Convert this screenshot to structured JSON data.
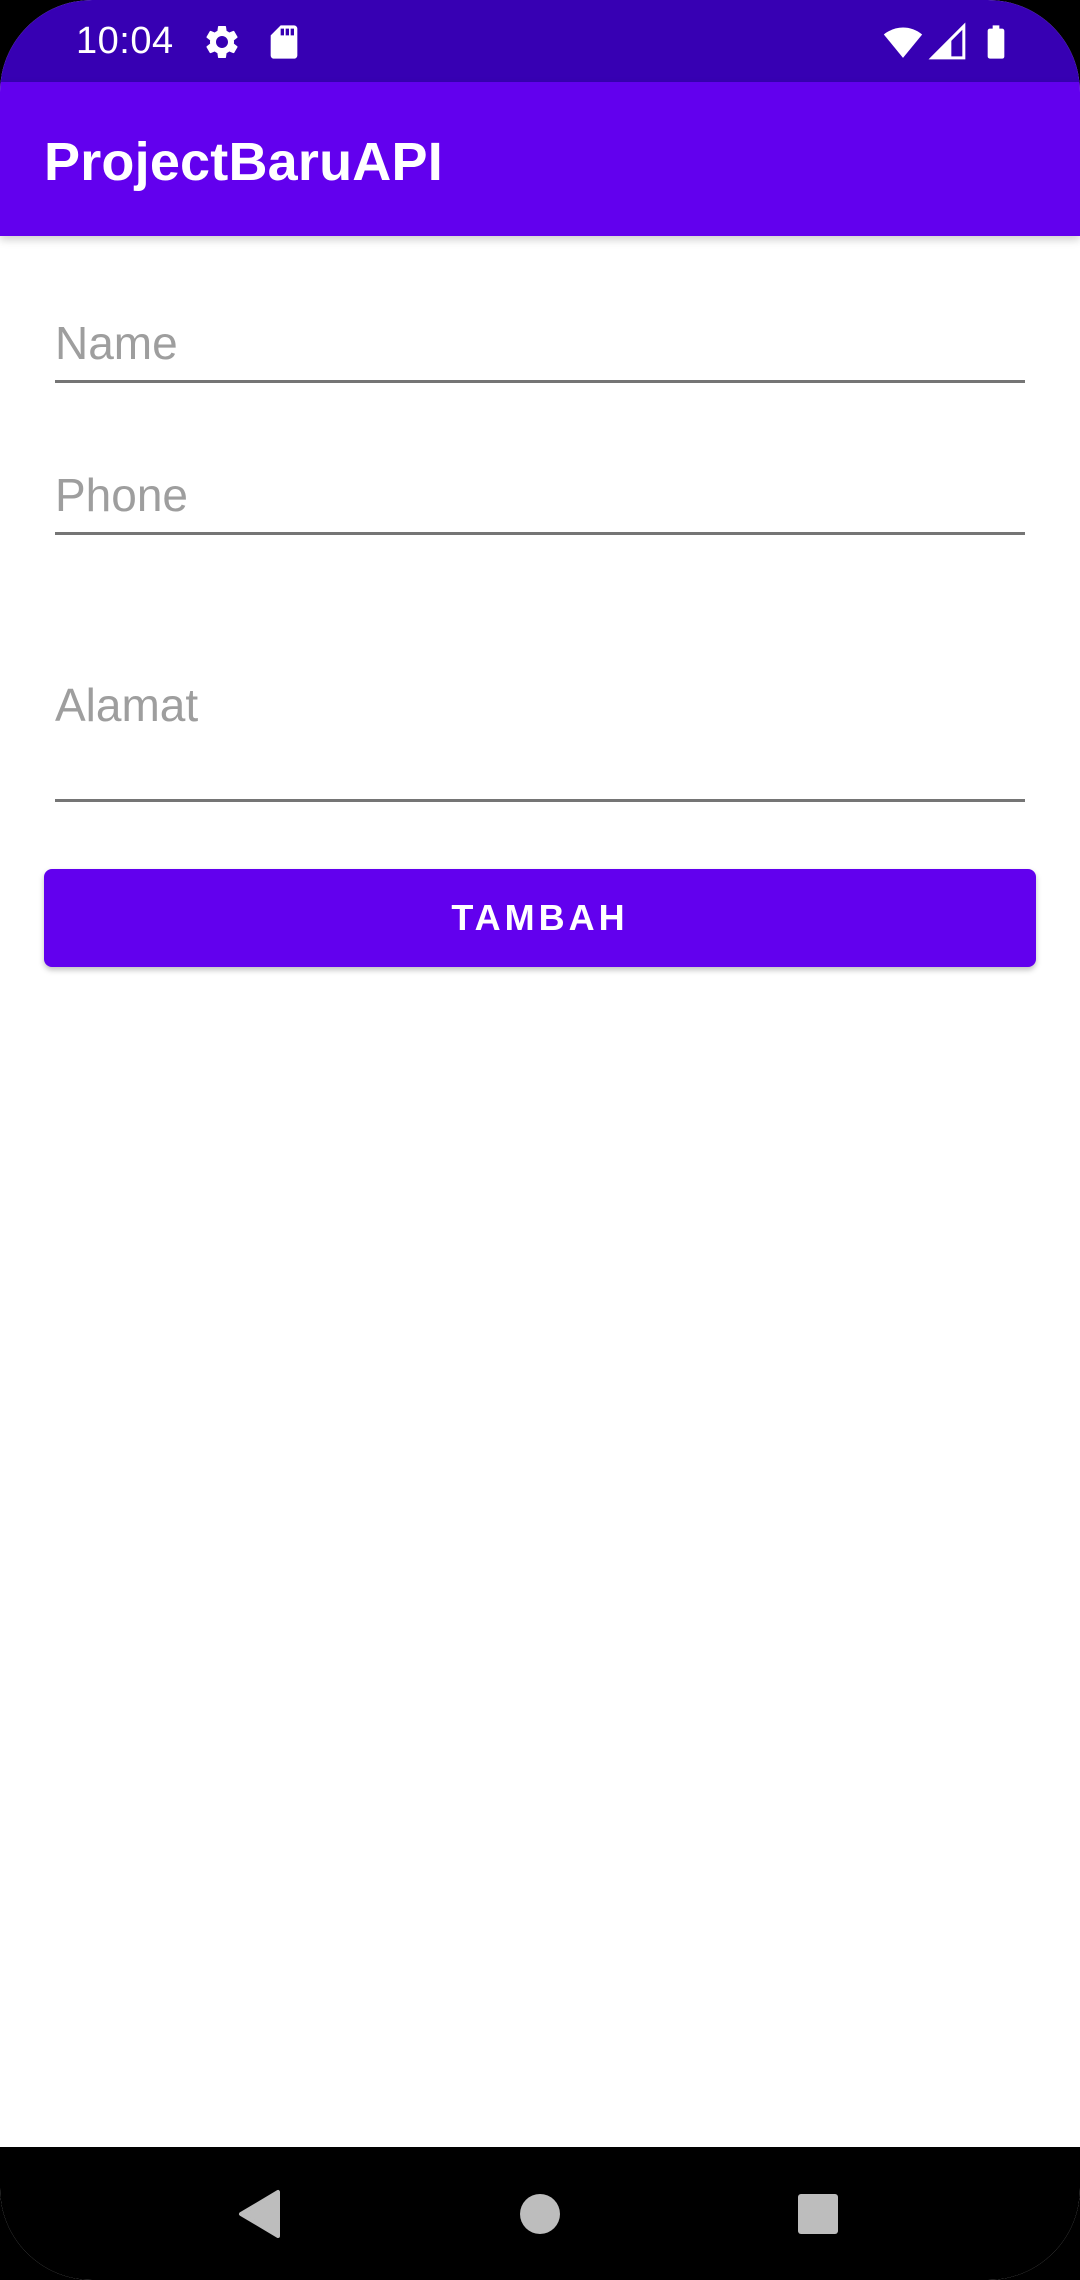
{
  "status_bar": {
    "time": "10:04",
    "left_icons": [
      "gear-icon",
      "sd-card-icon"
    ],
    "right_icons": [
      "wifi-icon",
      "cell-signal-icon",
      "battery-icon"
    ]
  },
  "app_bar": {
    "title": "ProjectBaruAPI"
  },
  "form": {
    "name": {
      "placeholder": "Name",
      "value": ""
    },
    "phone": {
      "placeholder": "Phone",
      "value": ""
    },
    "alamat": {
      "placeholder": "Alamat",
      "value": ""
    },
    "submit_label": "TAMBAH"
  },
  "nav_bar": {
    "buttons": [
      "back-icon",
      "home-icon",
      "recents-icon"
    ]
  },
  "colors": {
    "status_bar": "#3700b3",
    "primary": "#6200ee",
    "background": "#ffffff",
    "hint_text": "#9e9e9e",
    "underline": "#757575",
    "nav_bar": "#000000",
    "nav_icon": "#bdbdbd"
  }
}
